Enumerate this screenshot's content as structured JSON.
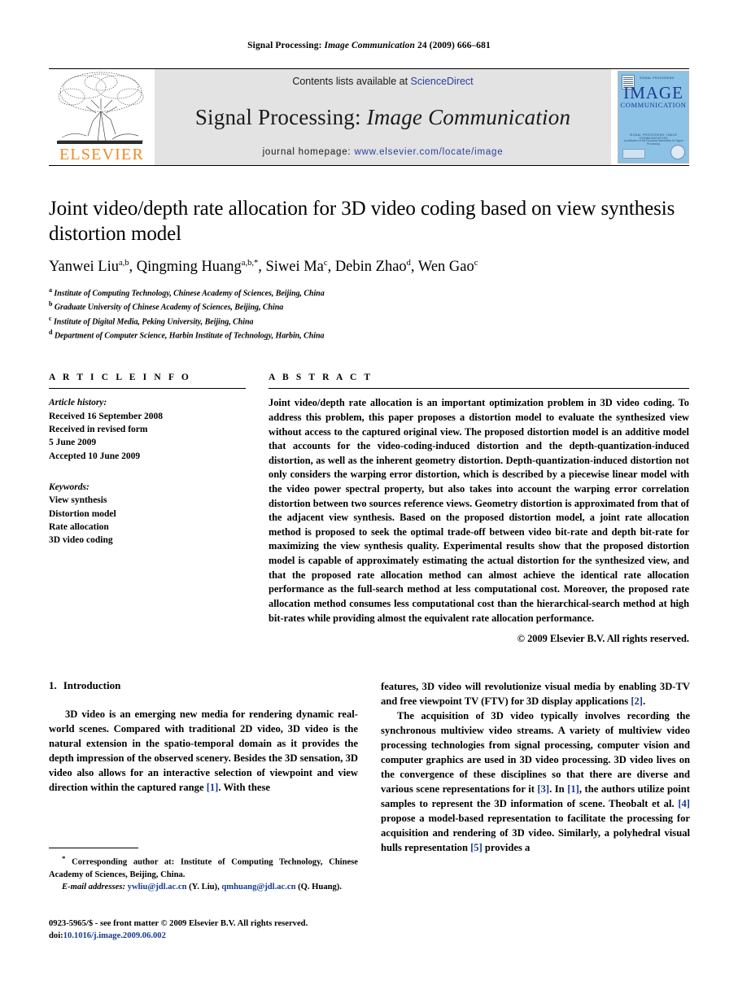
{
  "running_head": {
    "journal_prefix": "Signal Processing:",
    "journal_italic": "Image Communication",
    "volume_info": "24 (2009) 666–681"
  },
  "masthead": {
    "publisher_name": "ELSEVIER",
    "contents_text": "Contents lists available at",
    "sciencedirect_label": "ScienceDirect",
    "journal_title_plain": "Signal Processing:",
    "journal_title_italic": "Image Communication",
    "homepage_label": "journal homepage:",
    "homepage_url": "www.elsevier.com/locate/image",
    "cover": {
      "title": "IMAGE",
      "subtitle": "COMMUNICATION",
      "micro_top": "SIGNAL PROCESSING",
      "foot_line1": "SIGNAL PROCESSING: IMAGE COMMUNICATION",
      "foot_line2": "A publication of the European Association for Signal Processing"
    },
    "colors": {
      "link": "#2a3fa0",
      "elsevier_orange": "#ee8b22",
      "cover_blue": "#8cc2e6",
      "cover_text_blue": "#1b3a8f",
      "band_gray": "#e3e3e3"
    }
  },
  "article": {
    "title": "Joint video/depth rate allocation for 3D video coding based on view synthesis distortion model",
    "authors": [
      {
        "name": "Yanwei Liu",
        "sup": "a,b",
        "sep": ", "
      },
      {
        "name": "Qingming Huang",
        "sup": "a,b,*",
        "sep": ", "
      },
      {
        "name": "Siwei Ma",
        "sup": "c",
        "sep": ", "
      },
      {
        "name": "Debin Zhao",
        "sup": "d",
        "sep": ", "
      },
      {
        "name": "Wen Gao",
        "sup": "c",
        "sep": ""
      }
    ],
    "affiliations": [
      {
        "sup": "a",
        "text": "Institute of Computing Technology, Chinese Academy of Sciences, Beijing, China"
      },
      {
        "sup": "b",
        "text": "Graduate University of Chinese Academy of Sciences, Beijing, China"
      },
      {
        "sup": "c",
        "text": "Institute of Digital Media, Peking University, Beijing, China"
      },
      {
        "sup": "d",
        "text": "Department of Computer Science, Harbin Institute of Technology, Harbin, China"
      }
    ]
  },
  "article_info": {
    "heading": "A R T I C L E  I N F O",
    "history_label": "Article history:",
    "history_lines": [
      "Received 16 September 2008",
      "Received in revised form",
      "5 June 2009",
      "Accepted 10 June 2009"
    ],
    "keywords_label": "Keywords:",
    "keywords": [
      "View synthesis",
      "Distortion model",
      "Rate allocation",
      "3D video coding"
    ]
  },
  "abstract": {
    "heading": "A B S T R A C T",
    "text": "Joint video/depth rate allocation is an important optimization problem in 3D video coding. To address this problem, this paper proposes a distortion model to evaluate the synthesized view without access to the captured original view. The proposed distortion model is an additive model that accounts for the video-coding-induced distortion and the depth-quantization-induced distortion, as well as the inherent geometry distortion. Depth-quantization-induced distortion not only considers the warping error distortion, which is described by a piecewise linear model with the video power spectral property, but also takes into account the warping error correlation distortion between two sources reference views. Geometry distortion is approximated from that of the adjacent view synthesis. Based on the proposed distortion model, a joint rate allocation method is proposed to seek the optimal trade-off between video bit-rate and depth bit-rate for maximizing the view synthesis quality. Experimental results show that the proposed distortion model is capable of approximately estimating the actual distortion for the synthesized view, and that the proposed rate allocation method can almost achieve the identical rate allocation performance as the full-search method at less computational cost. Moreover, the proposed rate allocation method consumes less computational cost than the hierarchical-search method at high bit-rates while providing almost the equivalent rate allocation performance.",
    "copyright": "© 2009 Elsevier B.V. All rights reserved."
  },
  "introduction": {
    "number": "1.",
    "heading": "Introduction",
    "left_paragraph_1_a": "3D video is an emerging new media for rendering dynamic real-world scenes. Compared with traditional 2D video, 3D video is the natural extension in the spatio-temporal domain as it provides the depth impression of the observed scenery. Besides the 3D sensation, 3D video also allows for an interactive selection of viewpoint and view direction within the captured range ",
    "left_ref_1": "[1]",
    "left_paragraph_1_b": ". With these ",
    "right_paragraph_1_a": "features, 3D video will revolutionize visual media by enabling 3D-TV and free viewpoint TV (FTV) for 3D display applications ",
    "right_ref_2": "[2]",
    "right_paragraph_1_b": ".",
    "right_paragraph_2_a": "The acquisition of 3D video typically involves recording the synchronous multiview video streams. A variety of multiview video processing technologies from signal processing, computer vision and computer graphics are used in 3D video processing. 3D video lives on the convergence of these disciplines so that there are diverse and various scene representations for it ",
    "right_ref_3": "[3]",
    "right_paragraph_2_b": ". In ",
    "right_ref_1": "[1]",
    "right_paragraph_2_c": ", the authors utilize point samples to represent the 3D information of scene. Theobalt et al. ",
    "right_ref_4": "[4]",
    "right_paragraph_2_d": " propose a model-based representation to facilitate the processing for acquisition and rendering of 3D video. Similarly, a polyhedral visual hulls representation ",
    "right_ref_5": "[5]",
    "right_paragraph_2_e": " provides a"
  },
  "footnotes": {
    "corresponding_marker": "*",
    "corresponding_text": " Corresponding author at: Institute of Computing Technology, Chinese Academy of Sciences, Beijing, China.",
    "email_label": "E-mail addresses:",
    "email_1": "ywliu@jdl.ac.cn",
    "email_1_owner": " (Y. Liu),",
    "email_2": "qmhuang@jdl.ac.cn",
    "email_2_owner": " (Q. Huang)."
  },
  "issn_line": {
    "text": "0923-5965/$ - see front matter © 2009 Elsevier B.V. All rights reserved.",
    "doi_label": "doi:",
    "doi_value": "10.1016/j.image.2009.06.002"
  }
}
